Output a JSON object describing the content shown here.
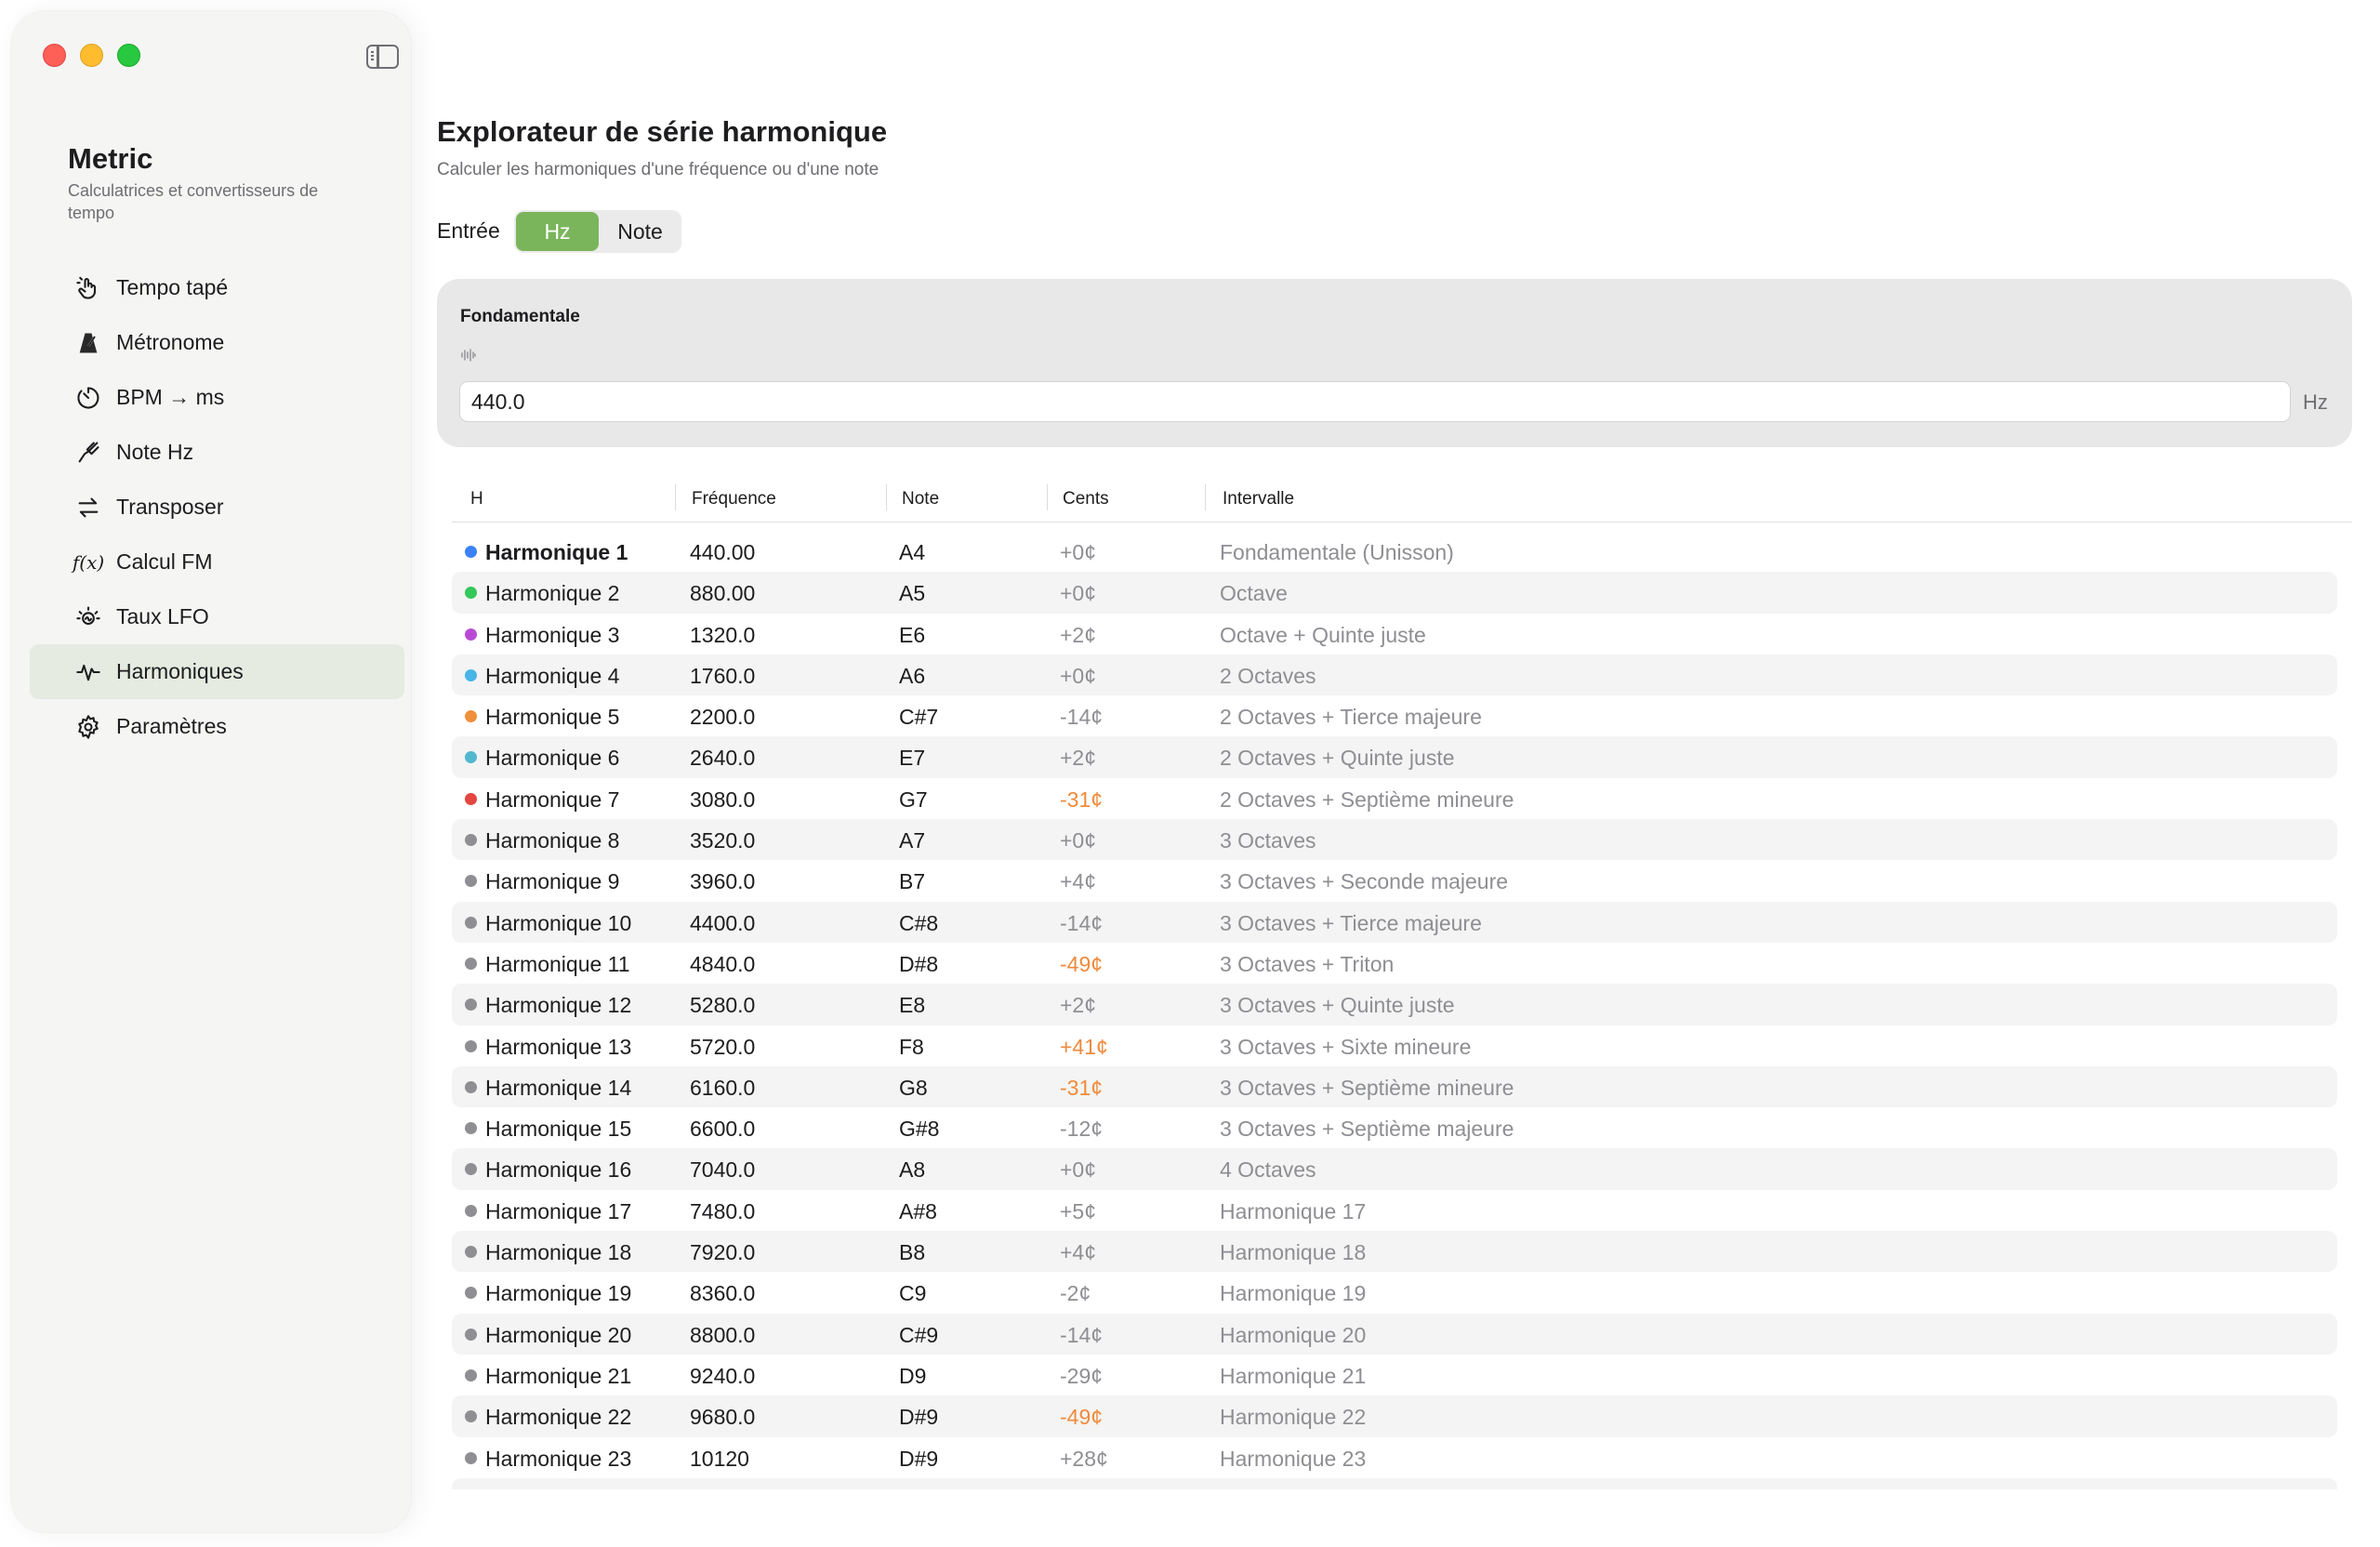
{
  "app": {
    "title": "Metric",
    "subtitle": "Calculatrices et convertisseurs de tempo"
  },
  "sidebar": {
    "items": [
      {
        "label": "Tempo tapé",
        "icon": "tap-hand-icon"
      },
      {
        "label": "Métronome",
        "icon": "metronome-icon"
      },
      {
        "label": "BPM → ms",
        "icon": "timer-icon"
      },
      {
        "label": "Note Hz",
        "icon": "tuning-fork-icon"
      },
      {
        "label": "Transposer",
        "icon": "swap-arrows-icon"
      },
      {
        "label": "Calcul FM",
        "icon": "function-icon"
      },
      {
        "label": "Taux LFO",
        "icon": "oscillator-icon"
      },
      {
        "label": "Harmoniques",
        "icon": "waveform-icon",
        "selected": true
      },
      {
        "label": "Paramètres",
        "icon": "gear-icon"
      }
    ]
  },
  "main": {
    "title": "Explorateur de série harmonique",
    "subtitle": "Calculer les harmoniques d'une fréquence ou d'une note",
    "entry_label": "Entrée",
    "segments": [
      "Hz",
      "Note"
    ],
    "selected_segment": "Hz",
    "fundamental": {
      "label": "Fondamentale",
      "value": "440.0",
      "unit": "Hz"
    },
    "table": {
      "columns": [
        "H",
        "Fréquence",
        "Note",
        "Cents",
        "Intervalle"
      ],
      "rows": [
        {
          "h": "Harmonique 1",
          "freq": "440.00",
          "note": "A4",
          "cents": "+0¢",
          "interval": "Fondamentale (Unisson)",
          "dot": "#3b82f6",
          "bold": true
        },
        {
          "h": "Harmonique 2",
          "freq": "880.00",
          "note": "A5",
          "cents": "+0¢",
          "interval": "Octave",
          "dot": "#34c759"
        },
        {
          "h": "Harmonique 3",
          "freq": "1320.0",
          "note": "E6",
          "cents": "+2¢",
          "interval": "Octave + Quinte juste",
          "dot": "#b94ad6"
        },
        {
          "h": "Harmonique 4",
          "freq": "1760.0",
          "note": "A6",
          "cents": "+0¢",
          "interval": "2 Octaves",
          "dot": "#47b5e6"
        },
        {
          "h": "Harmonique 5",
          "freq": "2200.0",
          "note": "C#7",
          "cents": "-14¢",
          "interval": "2 Octaves + Tierce majeure",
          "dot": "#f0903c"
        },
        {
          "h": "Harmonique 6",
          "freq": "2640.0",
          "note": "E7",
          "cents": "+2¢",
          "interval": "2 Octaves + Quinte juste",
          "dot": "#52b8cf"
        },
        {
          "h": "Harmonique 7",
          "freq": "3080.0",
          "note": "G7",
          "cents": "-31¢",
          "interval": "2 Octaves + Septième mineure",
          "dot": "#e5463f",
          "warn": true
        },
        {
          "h": "Harmonique 8",
          "freq": "3520.0",
          "note": "A7",
          "cents": "+0¢",
          "interval": "3 Octaves",
          "dot": "#8e8e93"
        },
        {
          "h": "Harmonique 9",
          "freq": "3960.0",
          "note": "B7",
          "cents": "+4¢",
          "interval": "3 Octaves + Seconde majeure",
          "dot": "#8e8e93"
        },
        {
          "h": "Harmonique 10",
          "freq": "4400.0",
          "note": "C#8",
          "cents": "-14¢",
          "interval": "3 Octaves + Tierce majeure",
          "dot": "#8e8e93"
        },
        {
          "h": "Harmonique 11",
          "freq": "4840.0",
          "note": "D#8",
          "cents": "-49¢",
          "interval": "3 Octaves + Triton",
          "dot": "#8e8e93",
          "warn": true
        },
        {
          "h": "Harmonique 12",
          "freq": "5280.0",
          "note": "E8",
          "cents": "+2¢",
          "interval": "3 Octaves + Quinte juste",
          "dot": "#8e8e93"
        },
        {
          "h": "Harmonique 13",
          "freq": "5720.0",
          "note": "F8",
          "cents": "+41¢",
          "interval": "3 Octaves + Sixte mineure",
          "dot": "#8e8e93",
          "warn": true
        },
        {
          "h": "Harmonique 14",
          "freq": "6160.0",
          "note": "G8",
          "cents": "-31¢",
          "interval": "3 Octaves + Septième mineure",
          "dot": "#8e8e93",
          "warn": true
        },
        {
          "h": "Harmonique 15",
          "freq": "6600.0",
          "note": "G#8",
          "cents": "-12¢",
          "interval": "3 Octaves + Septième majeure",
          "dot": "#8e8e93"
        },
        {
          "h": "Harmonique 16",
          "freq": "7040.0",
          "note": "A8",
          "cents": "+0¢",
          "interval": "4 Octaves",
          "dot": "#8e8e93"
        },
        {
          "h": "Harmonique 17",
          "freq": "7480.0",
          "note": "A#8",
          "cents": "+5¢",
          "interval": "Harmonique 17",
          "dot": "#8e8e93"
        },
        {
          "h": "Harmonique 18",
          "freq": "7920.0",
          "note": "B8",
          "cents": "+4¢",
          "interval": "Harmonique 18",
          "dot": "#8e8e93"
        },
        {
          "h": "Harmonique 19",
          "freq": "8360.0",
          "note": "C9",
          "cents": "-2¢",
          "interval": "Harmonique 19",
          "dot": "#8e8e93"
        },
        {
          "h": "Harmonique 20",
          "freq": "8800.0",
          "note": "C#9",
          "cents": "-14¢",
          "interval": "Harmonique 20",
          "dot": "#8e8e93"
        },
        {
          "h": "Harmonique 21",
          "freq": "9240.0",
          "note": "D9",
          "cents": "-29¢",
          "interval": "Harmonique 21",
          "dot": "#8e8e93"
        },
        {
          "h": "Harmonique 22",
          "freq": "9680.0",
          "note": "D#9",
          "cents": "-49¢",
          "interval": "Harmonique 22",
          "dot": "#8e8e93",
          "warn": true
        },
        {
          "h": "Harmonique 23",
          "freq": "10120",
          "note": "D#9",
          "cents": "+28¢",
          "interval": "Harmonique 23",
          "dot": "#8e8e93"
        }
      ]
    }
  },
  "colors": {
    "accent": "#7ab55c",
    "warning": "#f08a3c",
    "selected_bg": "#e5ebe0",
    "muted_text": "#8e8e93"
  }
}
